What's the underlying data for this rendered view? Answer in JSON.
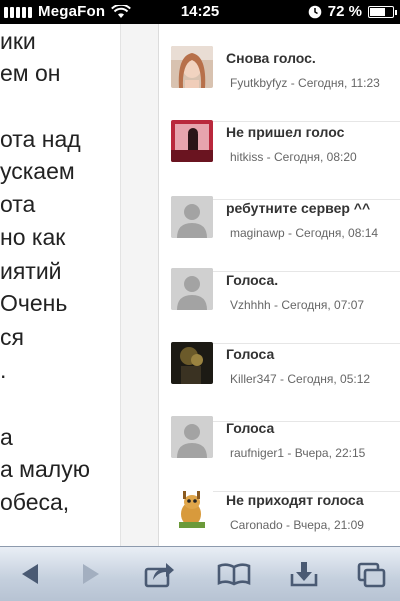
{
  "status_bar": {
    "carrier": "MegaFon",
    "time": "14:25",
    "battery_text": "72 %",
    "battery_level": 0.72,
    "signal_icon": "signal-bars-icon",
    "wifi_icon": "wifi-icon",
    "alarm_icon": "clock-icon"
  },
  "article": {
    "lines": [
      "ики",
      "ем он",
      "",
      "ота над",
      "ускаем",
      "ота",
      " но как",
      "иятий",
      "Очень",
      "ся",
      "."
    ]
  },
  "article_extra": {
    "lines": [
      "а",
      "а малую",
      "обеса,"
    ]
  },
  "comments": [
    {
      "title": "Снова голос.",
      "author": "Fyutkbyfyz",
      "sep": " - ",
      "date": "Сегодня, 11:23",
      "avatar": "photo-girl"
    },
    {
      "title": "Не пришел голос",
      "author": "hitkiss",
      "sep": " - ",
      "date": "Сегодня, 08:20",
      "avatar": "photo-pink"
    },
    {
      "title": "ребутните сервер ^^",
      "author": "maginawp",
      "sep": " - ",
      "date": "Сегодня, 08:14",
      "avatar": "default"
    },
    {
      "title": "Голоса.",
      "author": "Vzhhhh",
      "sep": " - ",
      "date": "Сегодня, 07:07",
      "avatar": "default"
    },
    {
      "title": "Голоса",
      "author": "Killer347",
      "sep": " - ",
      "date": "Сегодня, 05:12",
      "avatar": "photo-dark"
    },
    {
      "title": "Голоса",
      "author": "raufniger1",
      "sep": " - ",
      "date": "Вчера, 22:15",
      "avatar": "default"
    },
    {
      "title": "Не приходят голоса",
      "author": "Caronado",
      "sep": " - ",
      "date": "Вчера, 21:09",
      "avatar": "photo-giraffe"
    }
  ],
  "toolbar": {
    "back_icon": "back-arrow-icon",
    "forward_icon": "forward-arrow-icon",
    "share_icon": "share-icon",
    "bookmarks_icon": "bookmarks-icon",
    "reading_list_icon": "download-icon",
    "tabs_icon": "tabs-icon"
  },
  "colors": {
    "toolbar_icon": "#4a5a73",
    "meta_text": "#666666",
    "title_text": "#333333"
  }
}
